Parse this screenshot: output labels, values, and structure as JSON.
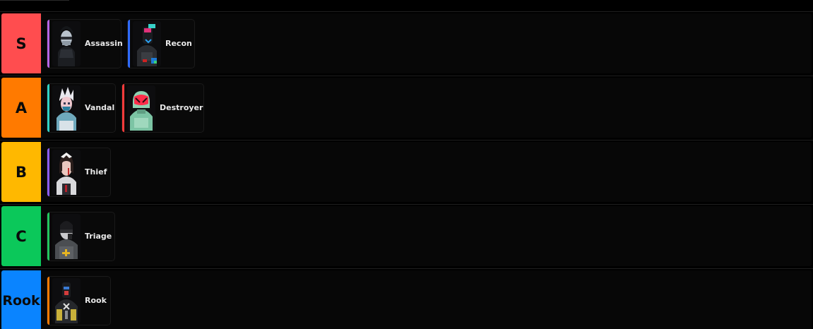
{
  "tiers": [
    {
      "label": "S",
      "color": "#ff4d4f",
      "items": [
        {
          "name": "Assassin",
          "accent": "#b565e6",
          "icon": "assassin-portrait"
        },
        {
          "name": "Recon",
          "accent": "#2f6bff",
          "icon": "recon-portrait"
        }
      ]
    },
    {
      "label": "A",
      "color": "#ff7a00",
      "items": [
        {
          "name": "Vandal",
          "accent": "#2fd1c4",
          "icon": "vandal-portrait"
        },
        {
          "name": "Destroyer",
          "accent": "#ff3b3b",
          "icon": "destroyer-portrait"
        }
      ]
    },
    {
      "label": "B",
      "color": "#ffb800",
      "items": [
        {
          "name": "Thief",
          "accent": "#8a5cff",
          "icon": "thief-portrait"
        }
      ]
    },
    {
      "label": "C",
      "color": "#0bc85a",
      "items": [
        {
          "name": "Triage",
          "accent": "#22c55e",
          "icon": "triage-portrait"
        }
      ]
    },
    {
      "label": "Rook",
      "color": "#0a84ff",
      "items": [
        {
          "name": "Rook",
          "accent": "#ff7a00",
          "icon": "rook-portrait"
        }
      ]
    }
  ]
}
